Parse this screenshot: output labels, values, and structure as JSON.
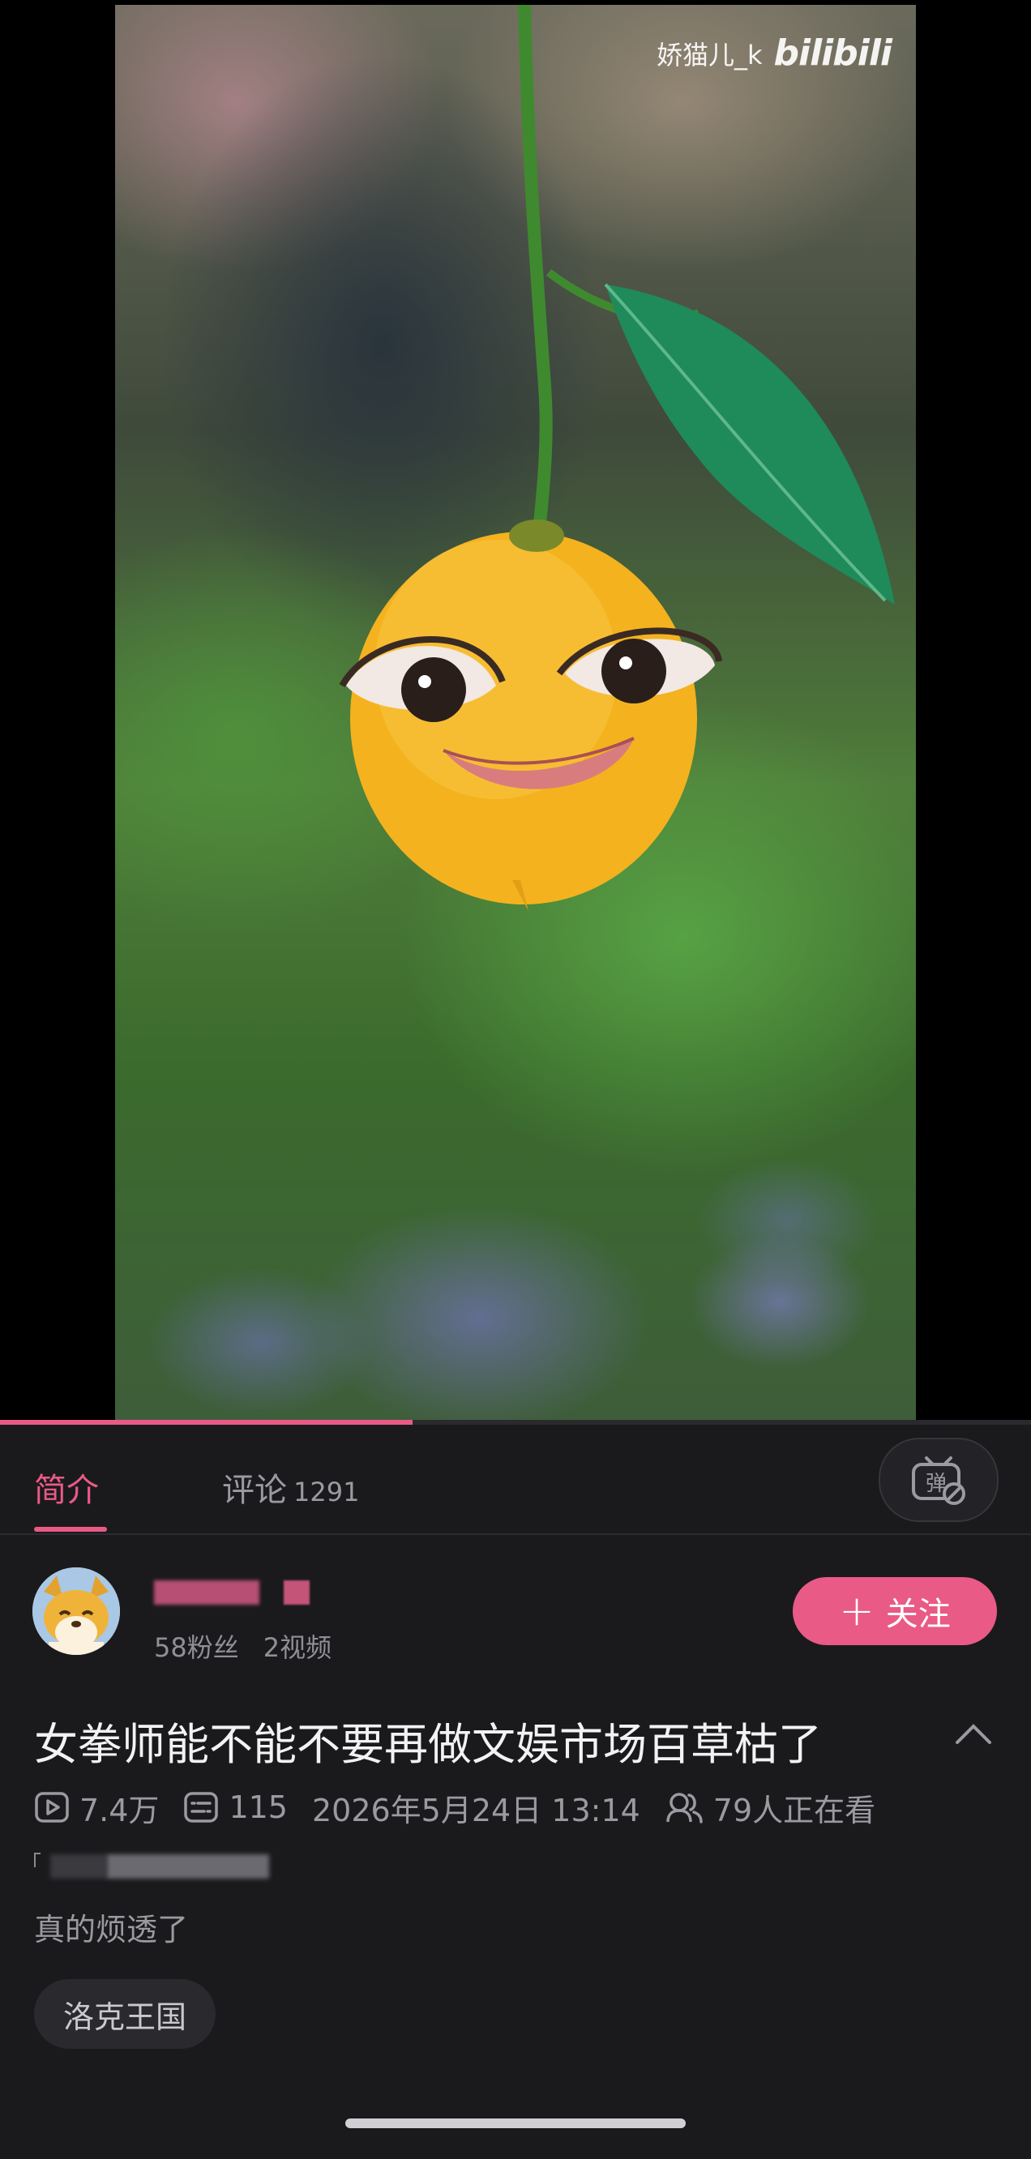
{
  "video": {
    "watermark_user": "娇猫儿_k",
    "watermark_brand": "bilibili",
    "progress_fraction": 0.4
  },
  "tabs": {
    "intro_label": "简介",
    "comments_label": "评论",
    "comments_count": "1291",
    "danmaku_icon": "danmaku-off-icon"
  },
  "uploader": {
    "fans": "58粉丝",
    "videos": "2视频",
    "follow_label": "关注"
  },
  "title": "女拳师能不能不要再做文娱市场百草枯了",
  "meta": {
    "views": "7.4万",
    "danmaku_count": "115",
    "datetime": "2026年5月24日 13:14",
    "watching": "79人正在看"
  },
  "description": "真的烦透了",
  "tags": [
    "洛克王国"
  ],
  "colors": {
    "accent": "#ea5a86",
    "background": "#1a1a1d"
  }
}
